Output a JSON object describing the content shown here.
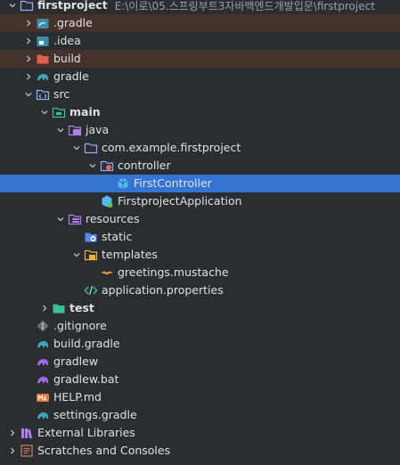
{
  "project_tree": {
    "root": {
      "label": "firstproject",
      "path": "E:\\이로\\05.스프링부트3자바백엔드개발입문\\firstproject"
    },
    "items": {
      "gradle_hidden": ".gradle",
      "idea": ".idea",
      "build": "build",
      "gradle": "gradle",
      "src": "src",
      "main": "main",
      "java": "java",
      "package": "com.example.firstproject",
      "controller": "controller",
      "first_controller": "FirstController",
      "app_class": "FirstprojectApplication",
      "resources": "resources",
      "static": "static",
      "templates": "templates",
      "mustache": "greetings.mustache",
      "properties": "application.properties",
      "test": "test",
      "gitignore": ".gitignore",
      "build_gradle": "build.gradle",
      "gradlew": "gradlew",
      "gradlew_bat": "gradlew.bat",
      "help": "HELP.md",
      "settings_gradle": "settings.gradle",
      "external_libs": "External Libraries",
      "scratches": "Scratches and Consoles"
    }
  },
  "colors": {
    "background": "#2b2d30",
    "excluded_row": "#45322b",
    "selection": "#2e436e",
    "folder_blue": "#548af7",
    "elephant_teal": "#3ba6b5",
    "elephant_purple": "#9f6ae6",
    "source_green": "#3dbf77"
  }
}
